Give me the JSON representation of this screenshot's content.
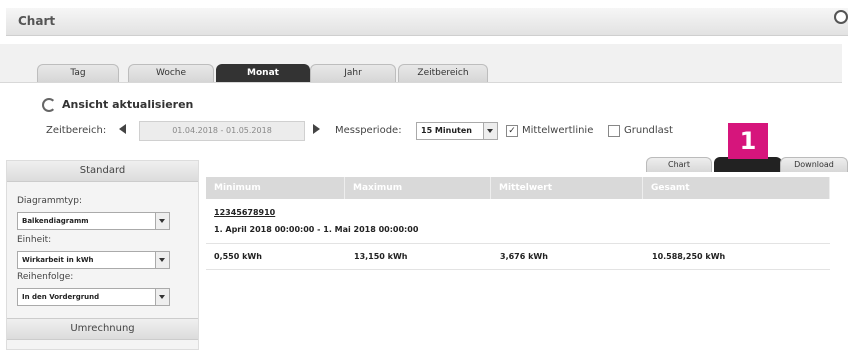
{
  "window": {
    "title": "Chart"
  },
  "tabs": [
    {
      "label": "Tag",
      "active": false
    },
    {
      "label": "Woche",
      "active": false
    },
    {
      "label": "Monat",
      "active": true
    },
    {
      "label": "Jahr",
      "active": false
    },
    {
      "label": "Zeitbereich",
      "active": false
    }
  ],
  "toolbar": {
    "refresh_label": "Ansicht aktualisieren",
    "zeitbereich_label": "Zeitbereich:",
    "date_range": "01.04.2018 - 01.05.2018",
    "messperiode_label": "Messperiode:",
    "messperiode_value": "15 Minuten",
    "mittelwertlinie_label": "Mittelwertlinie",
    "mittelwertlinie_checked": true,
    "grundlast_label": "Grundlast",
    "grundlast_checked": false
  },
  "sidebar": {
    "standard_label": "Standard",
    "diagrammtyp_label": "Diagrammtyp:",
    "diagrammtyp_value": "Balkendiagramm",
    "einheit_label": "Einheit:",
    "einheit_value": "Wirkarbeit in kWh",
    "reihenfolge_label": "Reihenfolge:",
    "reihenfolge_value": "In den Vordergrund",
    "umrechnung_label": "Umrechnung"
  },
  "view_tabs": [
    {
      "label": "Chart",
      "active": false
    },
    {
      "label": "",
      "active": true
    },
    {
      "label": "Download",
      "active": false
    }
  ],
  "badge": "1",
  "table": {
    "headers": [
      "Minimum",
      "Maximum",
      "Mittelwert",
      "Gesamt"
    ],
    "meter_id": "12345678910",
    "period": "1. April 2018 00:00:00 - 1. Mai 2018 00:00:00",
    "values": [
      "0,550 kWh",
      "13,150 kWh",
      "3,676 kWh",
      "10.588,250 kWh"
    ]
  },
  "colors": {
    "active_tab": "#333333",
    "badge": "#d6157c",
    "header_bg": "#d9d9d9"
  }
}
